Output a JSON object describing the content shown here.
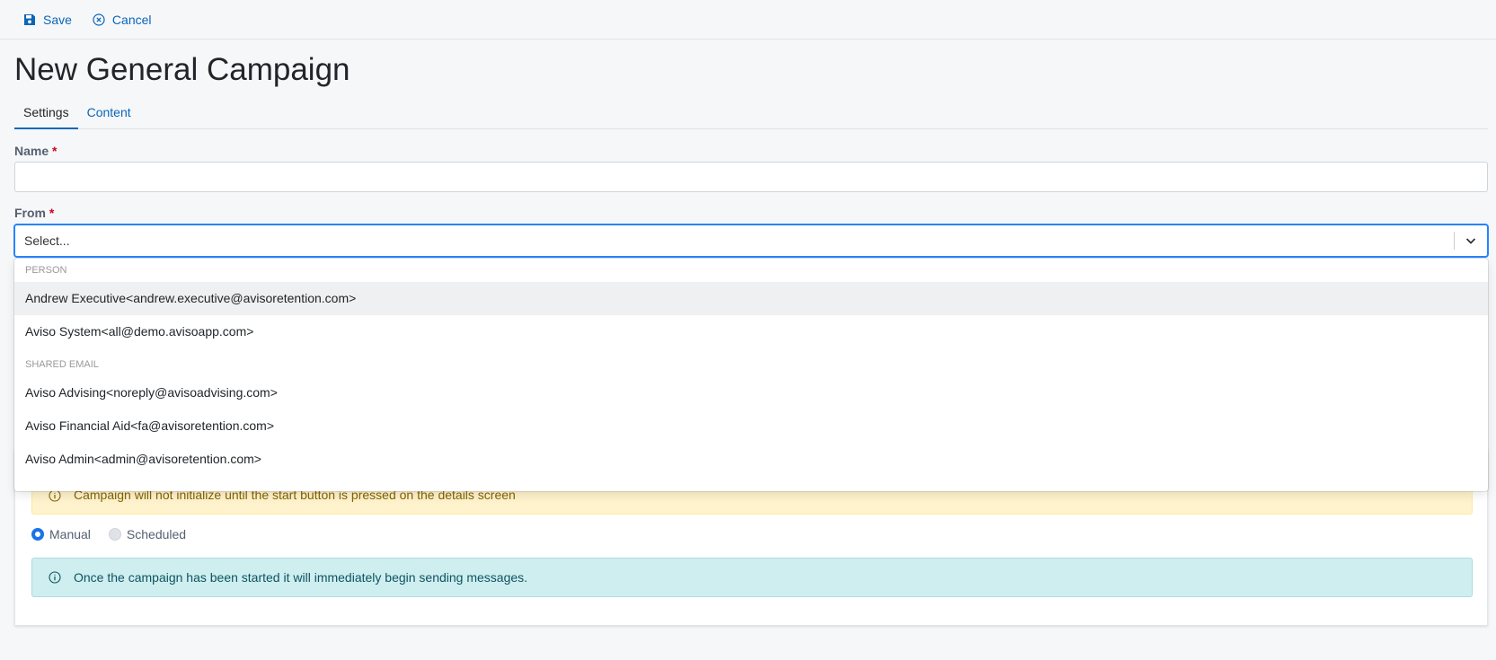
{
  "toolbar": {
    "save_label": "Save",
    "cancel_label": "Cancel"
  },
  "page": {
    "title": "New General Campaign"
  },
  "tabs": [
    {
      "label": "Settings",
      "active": true
    },
    {
      "label": "Content",
      "active": false
    }
  ],
  "form": {
    "name_label": "Name",
    "name_value": "",
    "from_label": "From",
    "required_mark": "*",
    "from_placeholder": "Select..."
  },
  "dropdown": {
    "groups": [
      {
        "heading": "PERSON",
        "options": [
          "Andrew Executive<andrew.executive@avisoretention.com>",
          "Aviso System<all@demo.avisoapp.com>"
        ]
      },
      {
        "heading": "SHARED EMAIL",
        "options": [
          "Aviso Advising<noreply@avisoadvising.com>",
          "Aviso Financial Aid<fa@avisoretention.com>",
          "Aviso Admin<admin@avisoretention.com>"
        ]
      }
    ]
  },
  "schedule": {
    "warning_text": "Campaign will not initialize until the start button is pressed on the details screen",
    "radio_manual": "Manual",
    "radio_scheduled": "Scheduled",
    "selected": "Manual",
    "info_text": "Once the campaign has been started it will immediately begin sending messages."
  },
  "colors": {
    "accent": "#0a66b7",
    "focus_border": "#2684ff",
    "required": "#d0021b",
    "warning_bg": "#fff3cd",
    "info_bg": "#cfeef0"
  },
  "icons": {
    "save": "floppy-disk-icon",
    "cancel": "circle-x-icon",
    "caret": "chevron-down-icon",
    "info": "info-circle-icon"
  }
}
